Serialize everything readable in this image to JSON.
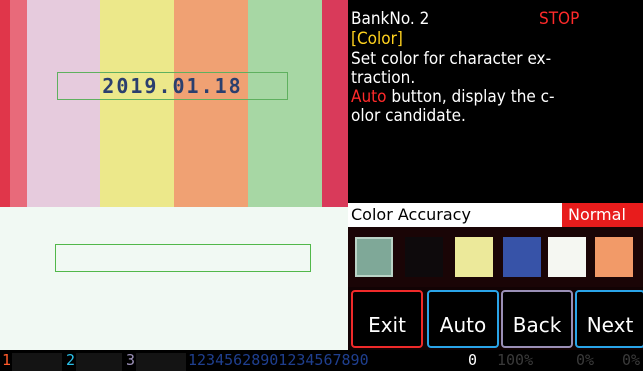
{
  "preview": {
    "date_text": "2019.01.18"
  },
  "info": {
    "bank_label": "BankNo. 2",
    "run_state": "STOP",
    "mode": "[Color]",
    "description": {
      "line1": "Set color for character ex-",
      "line2": "traction.",
      "line3_highlight": "Auto",
      "line3_rest": " button, display the c-",
      "line4": "olor candidate."
    }
  },
  "accuracy": {
    "label": "Color Accuracy",
    "value": "Normal"
  },
  "swatches": [
    {
      "name": "swatch-sage",
      "color": "#7fa898",
      "selected": true
    },
    {
      "name": "swatch-black",
      "color": "#0e0a0c",
      "selected": false
    },
    {
      "name": "swatch-yellow",
      "color": "#ece99a",
      "selected": false
    },
    {
      "name": "swatch-blue",
      "color": "#3753a8",
      "selected": false
    },
    {
      "name": "swatch-white",
      "color": "#f5f7f2",
      "selected": false
    },
    {
      "name": "swatch-orange",
      "color": "#f29a68",
      "selected": false
    }
  ],
  "buttons": {
    "exit": "Exit",
    "auto": "Auto",
    "back": "Back",
    "next": "Next"
  },
  "status_bar": {
    "bank1": "1",
    "bank2": "2",
    "bank3": "3",
    "digits": "12345628901234567890",
    "count": "0",
    "pct1": "100%",
    "pct2": "0%",
    "pct3": "0%"
  },
  "colors": {
    "stop": "#ff2a2a",
    "mode": "#ffd21e",
    "accuracy_bg": "#e81c1c"
  }
}
